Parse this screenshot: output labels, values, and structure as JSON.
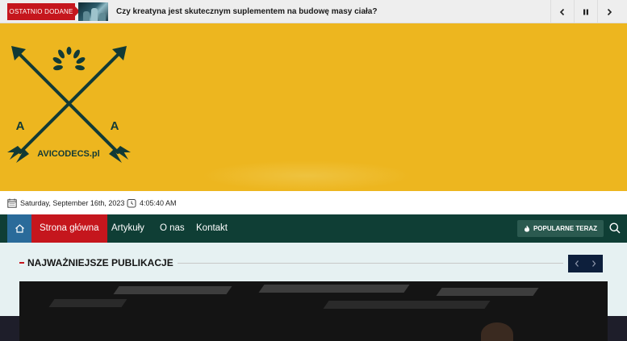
{
  "ticker": {
    "label": "OSTATNIO DODANE",
    "headline": "Czy kreatyna jest skutecznym suplementem na budowę masy ciała?",
    "controls": [
      "chevron-left-icon",
      "pause-icon",
      "chevron-right-icon"
    ]
  },
  "banner": {
    "logo_text": "AVICODECS.pl",
    "logo_letter_left": "A",
    "logo_letter_right": "A",
    "background_color": "#edb61f"
  },
  "datebar": {
    "date": "Saturday, September 16th, 2023",
    "time": "4:05:40 AM"
  },
  "nav": {
    "items": [
      {
        "label": "Strona główna",
        "active": true
      },
      {
        "label": "Artykuły",
        "active": false
      },
      {
        "label": "O nas",
        "active": false
      },
      {
        "label": "Kontakt",
        "active": false
      }
    ],
    "popular_label": "POPULARNE TERAZ",
    "colors": {
      "nav_bg": "#0f3e35",
      "active_bg": "#c5161d",
      "home_bg": "#2a6b9a"
    }
  },
  "main": {
    "section_title": "NAJWAŻNIEJSZE PUBLIKACJE"
  }
}
